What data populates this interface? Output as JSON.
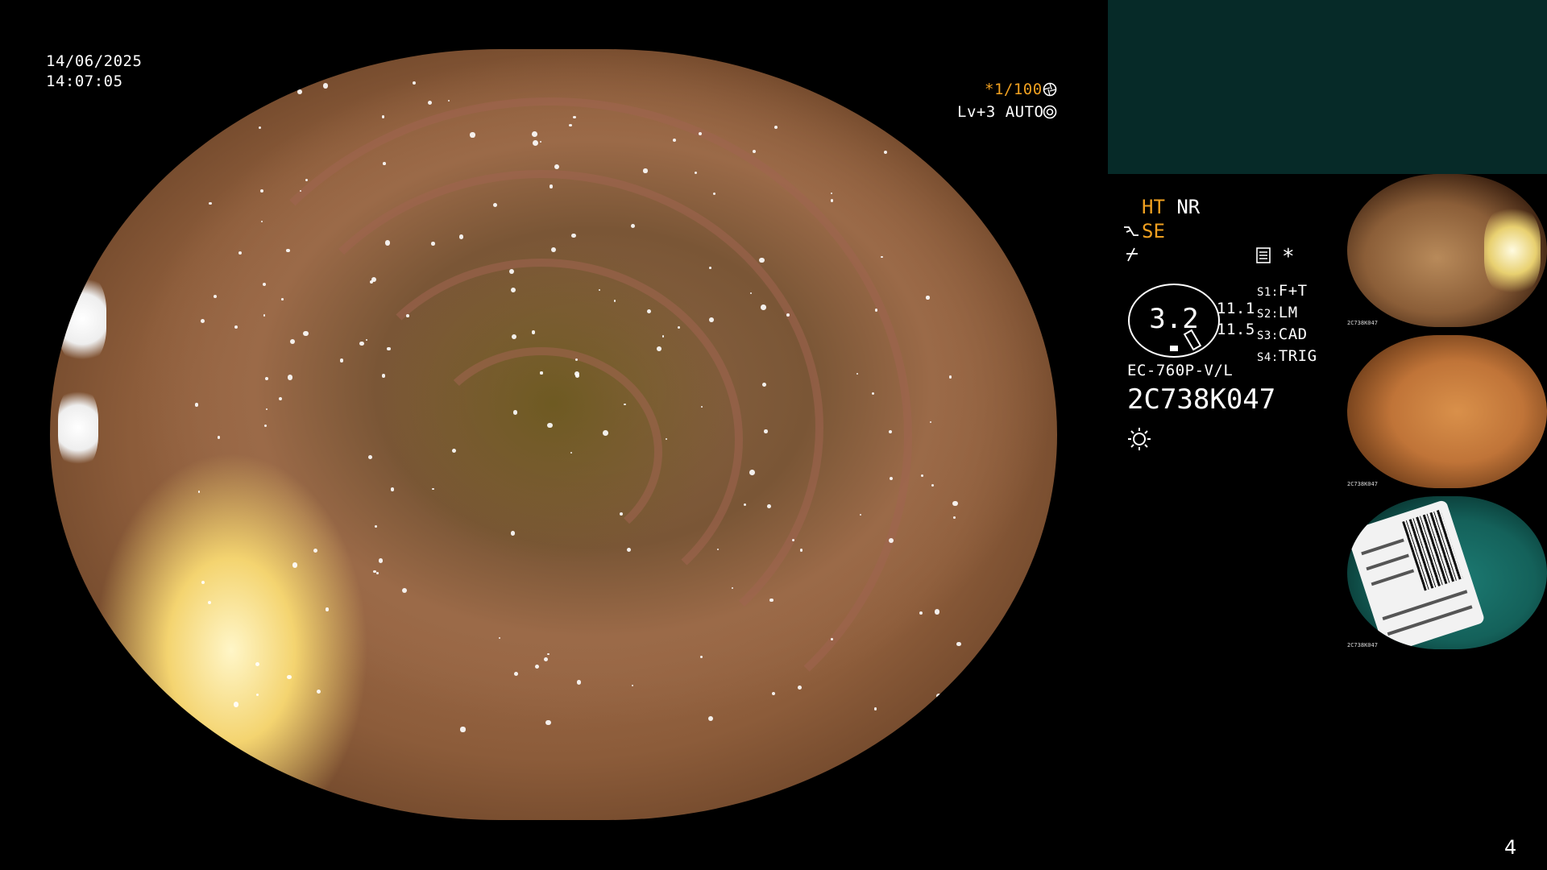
{
  "overlay": {
    "date": "14/06/2025",
    "time": "14:07:05",
    "shutter": "*1/100",
    "level": "Lv+3",
    "mode": "AUTO"
  },
  "panel": {
    "ht": "HT",
    "nr": "NR",
    "se": "SE",
    "gauge_value": "3.2",
    "reading_1": "11.1",
    "reading_2": "11.5",
    "scope_model": "EC-760P-V/L",
    "serial": "2C738K047",
    "star": "*",
    "switches": [
      {
        "key": "S1:",
        "value": "F+T"
      },
      {
        "key": "S2:",
        "value": "LM"
      },
      {
        "key": "S3:",
        "value": "CAD"
      },
      {
        "key": "S4:",
        "value": "TRIG"
      }
    ]
  },
  "thumbnails": [
    {
      "caption": "2C738K047",
      "tone": "mucosa-brown"
    },
    {
      "caption": "2C738K047",
      "tone": "mucosa-orange"
    },
    {
      "caption": "2C738K047",
      "tone": "label-teal"
    }
  ],
  "page_number": "4",
  "colors": {
    "accent_orange": "#f0a020",
    "panel_teal": "#062a28",
    "background": "#000000"
  },
  "icons": [
    "iris-icon",
    "brightness-target-icon",
    "freeze-icon",
    "record-icon",
    "sun-icon",
    "pen-icon"
  ]
}
